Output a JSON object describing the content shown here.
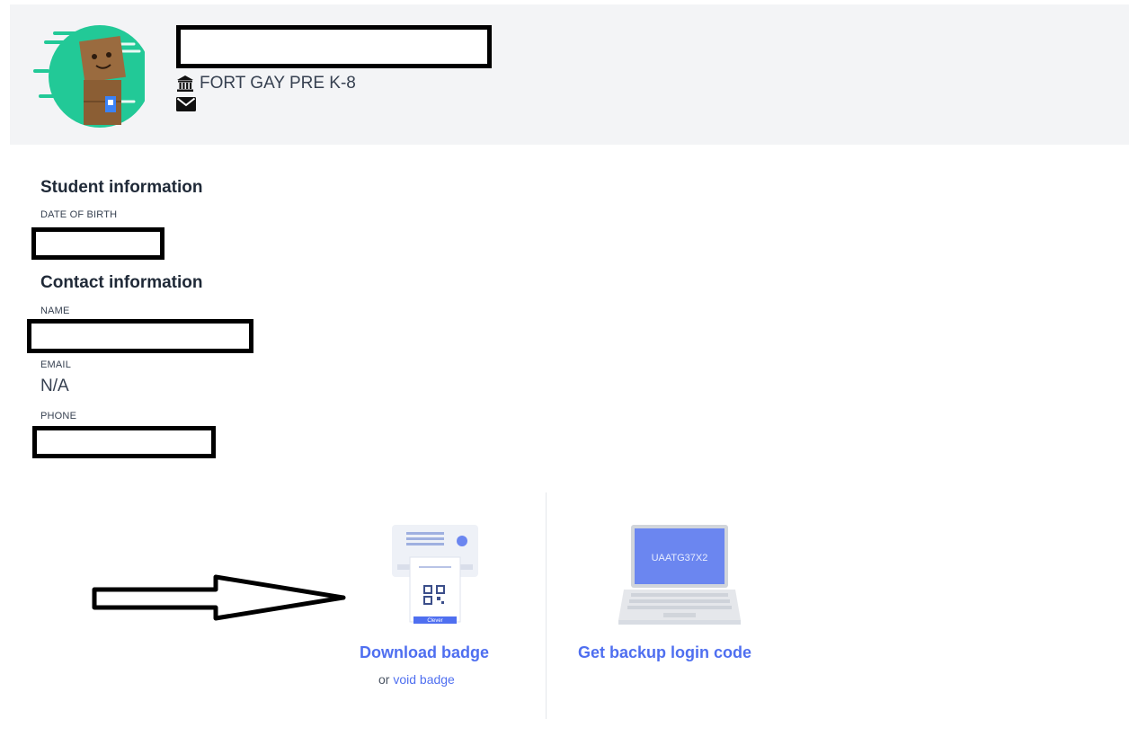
{
  "header": {
    "school_name": "FORT GAY PRE K-8",
    "school_icon": "institution-icon",
    "mail_icon": "envelope-icon"
  },
  "student_info": {
    "title": "Student information",
    "dob_label": "DATE OF BIRTH"
  },
  "contact_info": {
    "title": "Contact information",
    "name_label": "NAME",
    "email_label": "EMAIL",
    "email_value": "N/A",
    "phone_label": "PHONE"
  },
  "actions": {
    "download_badge": "Download badge",
    "or_text": "or",
    "void_badge": "void badge",
    "backup_code": "Get backup login code",
    "laptop_code": "UAATG37X2",
    "badge_name": "Clever"
  },
  "colors": {
    "accent": "#4f6ff0",
    "avatar_bg": "#22c997",
    "header_bg": "#f3f4f6"
  }
}
